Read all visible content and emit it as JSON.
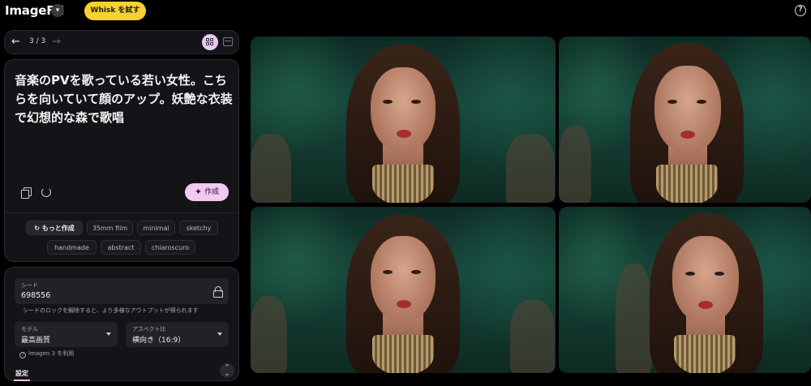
{
  "app": {
    "title": "ImageFX",
    "whisk_button": "Whisk を試す",
    "help_icon": "?"
  },
  "nav": {
    "page_count": "3 / 3"
  },
  "prompt": {
    "text": "音楽のPVを歌っている若い女性。こちらを向いていて顔のアップ。妖艶な衣装で幻想的な森で歌唱",
    "create_label": "作成"
  },
  "chips": {
    "more": "もっと作成",
    "items": [
      "35mm film",
      "minimal",
      "sketchy",
      "handmade",
      "abstract",
      "chiaroscuro"
    ]
  },
  "settings": {
    "seed_label": "シード",
    "seed_value": "698556",
    "seed_hint": "シードのロックを解除すると、より多様なアウトプットが得られます",
    "model_label": "モデル",
    "model_value": "最高画質",
    "aspect_label": "アスペクト比",
    "aspect_value": "横向き（16:9）",
    "imagen_note": "Imagen 3 を利用",
    "tab_label": "設定"
  },
  "colors": {
    "accent_pink": "#f3c9f0",
    "whisk_yellow": "#f6d130",
    "background": "#000000",
    "panel": "#141418"
  }
}
